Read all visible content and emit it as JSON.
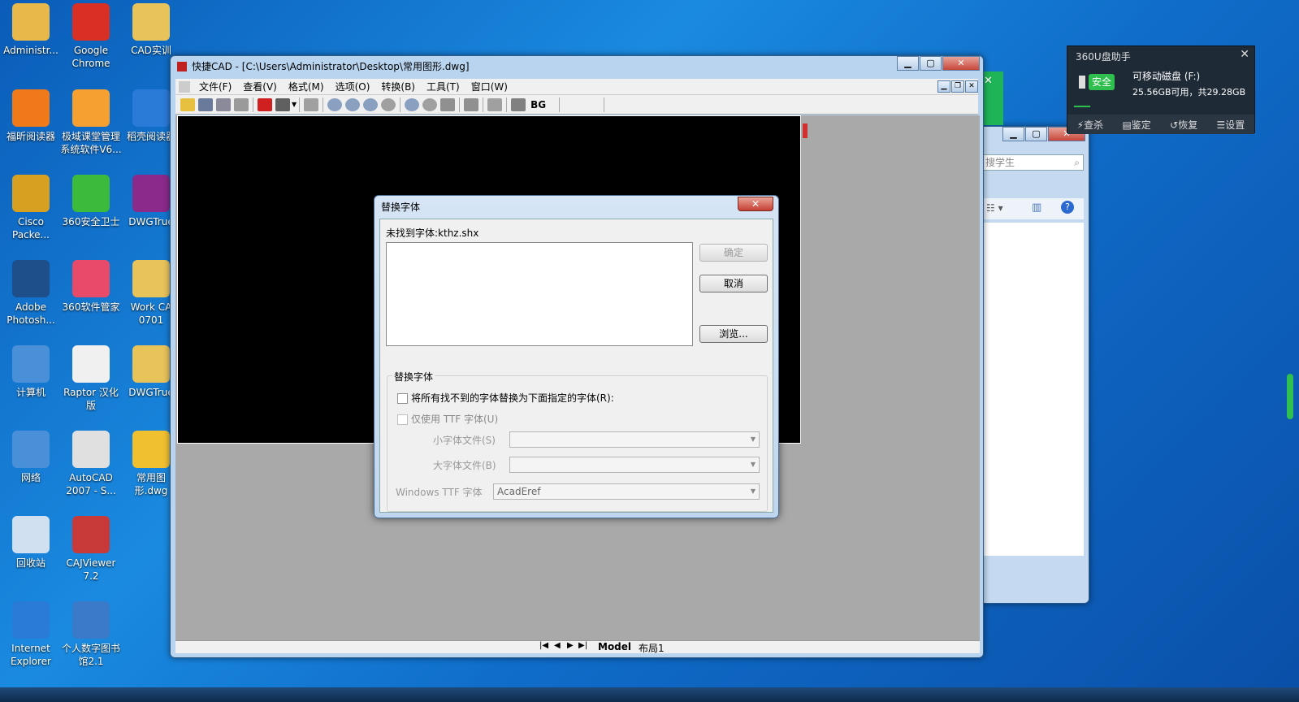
{
  "desktop": {
    "icons": [
      {
        "label": "Administr...",
        "icon": "user-folder-icon",
        "color": "#e8b84a"
      },
      {
        "label": "Google Chrome",
        "icon": "chrome-icon",
        "color": "#d93025"
      },
      {
        "label": "CAD实训",
        "icon": "folder-icon",
        "color": "#e8c35a"
      },
      {
        "label": "福昕阅读器",
        "icon": "pdf-reader-icon",
        "color": "#f07a1a"
      },
      {
        "label": "极域课堂管理系统软件V6...",
        "icon": "classroom-icon",
        "color": "#f5a030"
      },
      {
        "label": "稻壳阅读器",
        "icon": "reader-icon",
        "color": "#2a7ad8"
      },
      {
        "label": "Cisco Packe...",
        "icon": "cisco-icon",
        "color": "#d8a020"
      },
      {
        "label": "360安全卫士",
        "icon": "shield-360-icon",
        "color": "#3cba3c"
      },
      {
        "label": "DWGTrue",
        "icon": "winrar-icon",
        "color": "#8a2a8a"
      },
      {
        "label": "Adobe Photosh...",
        "icon": "photoshop-icon",
        "color": "#1e4f8a"
      },
      {
        "label": "360软件管家",
        "icon": "software-manager-icon",
        "color": "#e84a6a"
      },
      {
        "label": "Work CA 0701",
        "icon": "folder-icon",
        "color": "#e8c35a"
      },
      {
        "label": "计算机",
        "icon": "computer-icon",
        "color": "#4a90d8"
      },
      {
        "label": "Raptor 汉化版",
        "icon": "raptor-icon",
        "color": "#f0f0f0"
      },
      {
        "label": "DWGTrue",
        "icon": "folder-icon",
        "color": "#e8c35a"
      },
      {
        "label": "网络",
        "icon": "network-icon",
        "color": "#4a90d8"
      },
      {
        "label": "AutoCAD 2007 - S...",
        "icon": "autocad-icon",
        "color": "#e0e0e0"
      },
      {
        "label": "常用图形.dwg",
        "icon": "dwg-file-icon",
        "color": "#f0c030"
      },
      {
        "label": "回收站",
        "icon": "recycle-bin-icon",
        "color": "#d0e0f0"
      },
      {
        "label": "CAJViewer 7.2",
        "icon": "cajviewer-icon",
        "color": "#c83a3a"
      },
      {
        "label": "Internet Explorer",
        "icon": "ie-icon",
        "color": "#2a7ad8"
      },
      {
        "label": "个人数字图书馆2.1",
        "icon": "library-icon",
        "color": "#3a7ac8"
      }
    ]
  },
  "cad_window": {
    "title": "快捷CAD - [C:\\Users\\Administrator\\Desktop\\常用图形.dwg]",
    "menus": [
      "文件(F)",
      "查看(V)",
      "格式(M)",
      "选项(O)",
      "转换(B)",
      "工具(T)",
      "窗口(W)"
    ],
    "toolbar_bg_label": "BG",
    "tabs": [
      "Model",
      "布局1"
    ],
    "active_tab": "Model"
  },
  "dialog": {
    "title": "替换字体",
    "missing_font_label": "未找到字体:kthz.shx",
    "ok_label": "确定",
    "cancel_label": "取消",
    "browse_label": "浏览...",
    "group_label": "替换字体",
    "replace_all_label": "将所有找不到的字体替换为下面指定的字体(R):",
    "ttf_only_label": "仅使用 TTF 字体(U)",
    "small_font_label": "小字体文件(S)",
    "big_font_label": "大字体文件(B)",
    "windows_ttf_label": "Windows TTF 字体",
    "windows_ttf_value": "AcadEref"
  },
  "usb_helper": {
    "title": "360U盘助手",
    "status": "安全",
    "disk_name": "可移动磁盘 (F:)",
    "disk_space": "25.56GB可用，共29.28GB",
    "actions": [
      "查杀",
      "鉴定",
      "恢复",
      "设置"
    ]
  },
  "explorer_window": {
    "search_placeholder": "搜学生"
  }
}
